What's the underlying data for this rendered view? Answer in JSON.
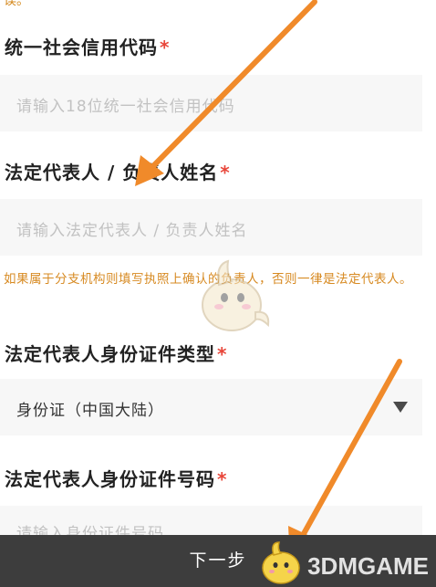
{
  "top_note": "误。",
  "fields": {
    "credit_code": {
      "label": "统一社会信用代码",
      "required_mark": "*",
      "placeholder": "请输入18位统一社会信用代码"
    },
    "legal_rep_name": {
      "label": "法定代表人 / 负责人姓名",
      "required_mark": "*",
      "placeholder": "请输入法定代表人 / 负责人姓名"
    },
    "hint": "如果属于分支机构则填写执照上确认的负责人，否则一律是法定代表人。",
    "id_type": {
      "label": "法定代表人身份证件类型",
      "required_mark": "*",
      "selected": "身份证（中国大陆）"
    },
    "id_number": {
      "label": "法定代表人身份证件号码",
      "required_mark": "*",
      "placeholder": "请输入身份证件号码"
    }
  },
  "bottom_bar": {
    "next_label": "下一步"
  },
  "watermark": {
    "text": "3DMGAME"
  },
  "colors": {
    "required": "#e8463a",
    "hint": "#d78a22",
    "arrow": "#f08a2a",
    "bottom_bar": "#3d3d3d"
  }
}
